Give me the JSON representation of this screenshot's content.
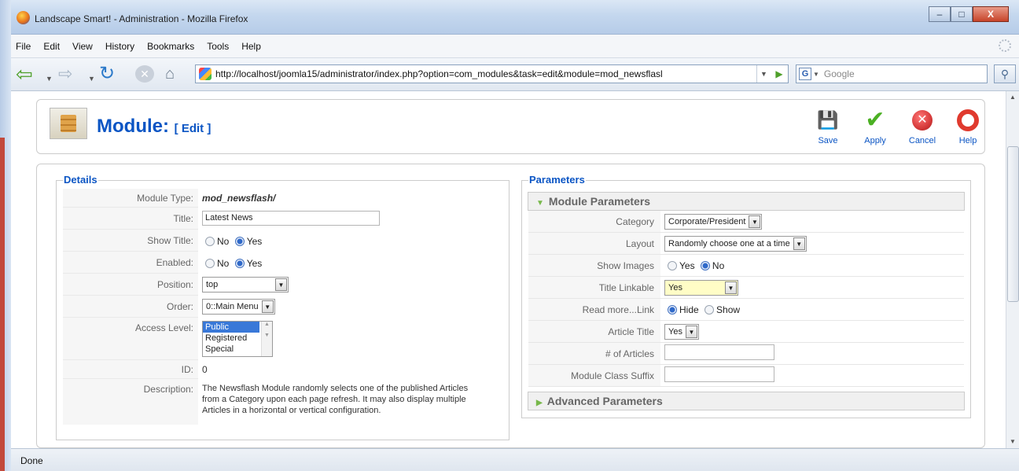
{
  "window": {
    "title": "Landscape Smart! - Administration - Mozilla Firefox",
    "controls": {
      "minimize": "–",
      "maximize": "□",
      "close": "X"
    }
  },
  "menubar": [
    "File",
    "Edit",
    "View",
    "History",
    "Bookmarks",
    "Tools",
    "Help"
  ],
  "navbar": {
    "url": "http://localhost/joomla15/administrator/index.php?option=com_modules&task=edit&module=mod_newsflasl",
    "search_placeholder": "Google",
    "search_engine": "G"
  },
  "header": {
    "title": "Module:",
    "subtitle": "[ Edit ]"
  },
  "toolbar": {
    "save": "Save",
    "apply": "Apply",
    "cancel": "Cancel",
    "help": "Help"
  },
  "details": {
    "legend": "Details",
    "module_type_label": "Module Type:",
    "module_type_value": "mod_newsflash/",
    "title_label": "Title:",
    "title_value": "Latest News",
    "show_title_label": "Show Title:",
    "enabled_label": "Enabled:",
    "no": "No",
    "yes": "Yes",
    "position_label": "Position:",
    "position_value": "top",
    "order_label": "Order:",
    "order_value": "0::Main Menu",
    "access_label": "Access Level:",
    "access_options": [
      "Public",
      "Registered",
      "Special"
    ],
    "id_label": "ID:",
    "id_value": "0",
    "description_label": "Description:",
    "description_value": "The Newsflash Module randomly selects one of the published Articles from a Category upon each page refresh. It may also display multiple Articles in a horizontal or vertical configuration."
  },
  "parameters": {
    "legend": "Parameters",
    "module_params_title": "Module Parameters",
    "advanced_params_title": "Advanced Parameters",
    "category_label": "Category",
    "category_value": "Corporate/President",
    "layout_label": "Layout",
    "layout_value": "Randomly choose one at a time",
    "show_images_label": "Show Images",
    "yes": "Yes",
    "no": "No",
    "title_linkable_label": "Title Linkable",
    "title_linkable_value": "Yes",
    "read_more_label": "Read more...Link",
    "hide": "Hide",
    "show": "Show",
    "article_title_label": "Article Title",
    "article_title_value": "Yes",
    "num_articles_label": "# of Articles",
    "class_suffix_label": "Module Class Suffix"
  },
  "status": "Done"
}
